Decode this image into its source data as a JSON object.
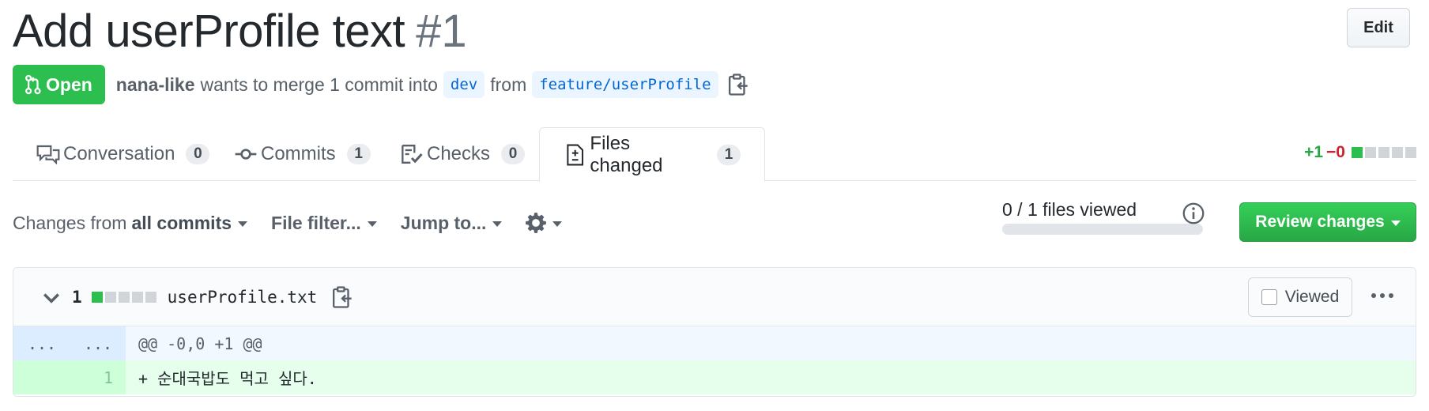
{
  "header": {
    "title": "Add userProfile text",
    "number": "#1",
    "edit_label": "Edit"
  },
  "meta": {
    "state": "Open",
    "author": "nana-like",
    "text_before": "wants to merge 1 commit into",
    "base_branch": "dev",
    "text_from": "from",
    "head_branch": "feature/userProfile"
  },
  "tabs": [
    {
      "label": "Conversation",
      "count": "0"
    },
    {
      "label": "Commits",
      "count": "1"
    },
    {
      "label": "Checks",
      "count": "0"
    },
    {
      "label": "Files changed",
      "count": "1"
    }
  ],
  "diffstat": {
    "additions": "+1",
    "deletions": "−0",
    "blocks": [
      "green",
      "gray",
      "gray",
      "gray",
      "gray"
    ]
  },
  "toolbar": {
    "changes_prefix": "Changes from",
    "changes_value": "all commits",
    "file_filter": "File filter...",
    "jump_to": "Jump to...",
    "files_viewed": "0 / 1 files viewed",
    "files_viewed_fraction": 0,
    "review_label": "Review changes"
  },
  "file": {
    "change_count": "1",
    "name": "userProfile.txt",
    "viewed_label": "Viewed",
    "blocks": [
      "green",
      "gray",
      "gray",
      "gray",
      "gray"
    ],
    "hunk": {
      "left": "...",
      "right": "...",
      "header": "@@ -0,0 +1 @@"
    },
    "lines": [
      {
        "left_num": "",
        "right_num": "1",
        "text": "+ 순대국밥도 먹고 싶다."
      }
    ]
  },
  "colors": {
    "open_green": "#2cbe4e",
    "addition": "#28a745",
    "deletion": "#cb2431",
    "branch_blue": "#0366d6"
  }
}
